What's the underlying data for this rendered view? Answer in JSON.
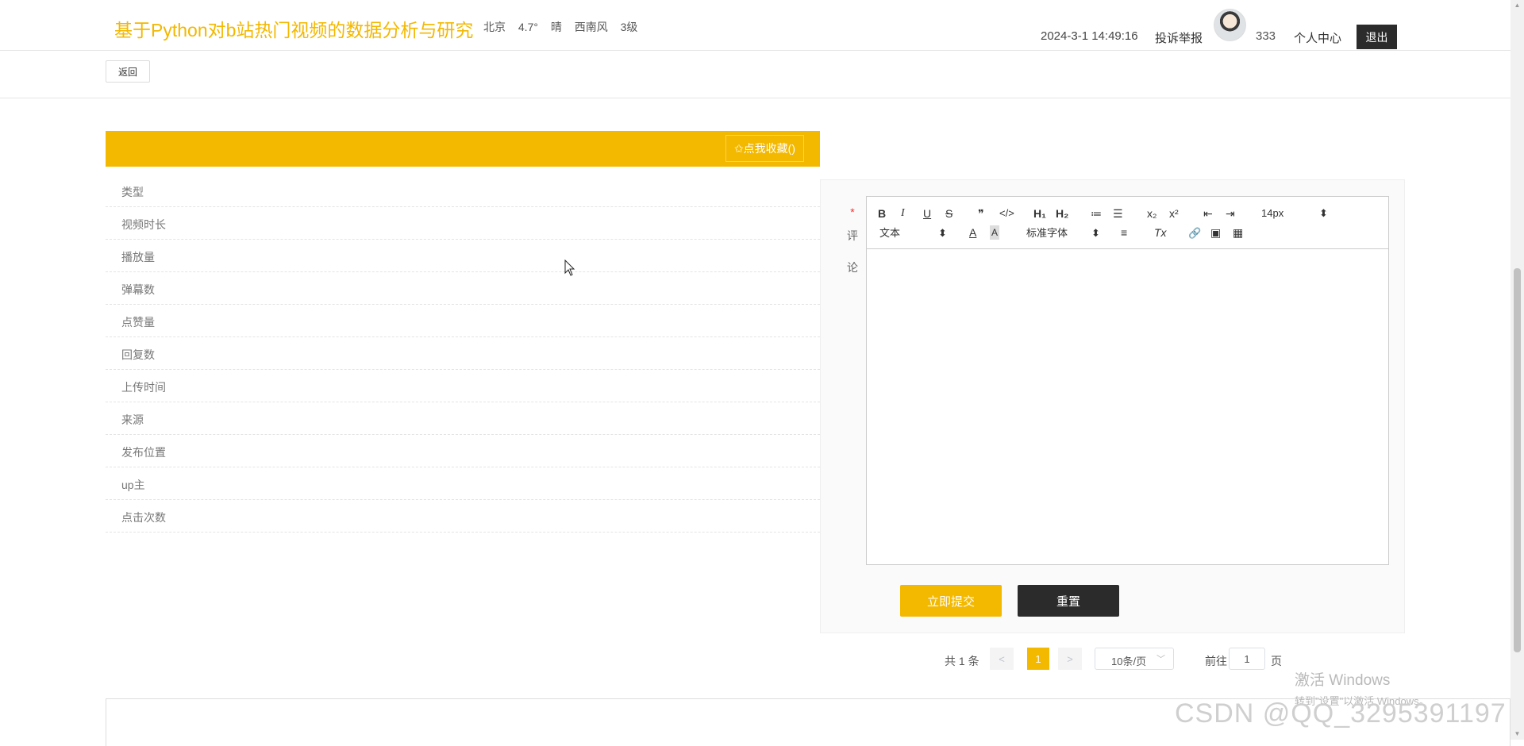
{
  "header": {
    "site_title": "基于Python对b站热门视频的数据分析与研究",
    "weather": {
      "city": "北京",
      "temp": "4.7°",
      "condition": "晴",
      "wind": "西南风",
      "level": "3级"
    },
    "datetime": "2024-3-1 14:49:16",
    "report_link": "投诉举报",
    "username": "333",
    "personal_center": "个人中心",
    "logout": "退出"
  },
  "back_button": "返回",
  "detail": {
    "favorite_button": "✩点我收藏()",
    "labels": [
      "类型",
      "视频时长",
      "播放量",
      "弹幕数",
      "点赞量",
      "回复数",
      "上传时间",
      "来源",
      "发布位置",
      "up主",
      "点击次数"
    ]
  },
  "comment": {
    "required_mark": "*",
    "label_1": "评",
    "label_2": "论",
    "toolbar": {
      "bold": "B",
      "italic": "I",
      "underline": "U",
      "strike": "S",
      "quote": "❞",
      "code": "</>",
      "h1": "H₁",
      "h2": "H₂",
      "ordered_list": "≔",
      "bullet_list": "☰",
      "subscript": "x₂",
      "superscript": "x²",
      "outdent": "⇤",
      "indent": "⇥",
      "size": "14px",
      "size_arrow": "⬍",
      "block": "文本",
      "block_arrow": "⬍",
      "color": "A",
      "background": "A",
      "font": "标准字体",
      "font_arrow": "⬍",
      "align": "≡",
      "clean": "Tx",
      "link": "🔗",
      "image": "▣",
      "video": "▦"
    },
    "submit": "立即提交",
    "reset": "重置"
  },
  "pagination": {
    "total": "共 1 条",
    "prev": "<",
    "current_page": "1",
    "next": ">",
    "page_size": "10条/页",
    "goto_label": "前往",
    "goto_value": "1",
    "page_unit": "页"
  },
  "watermark": {
    "windows_line1": "激活 Windows",
    "windows_line2": "转到\"设置\"以激活 Windows。",
    "csdn": "CSDN @QQ_3295391197"
  },
  "colors": {
    "accent": "#f3b800",
    "dark": "#2b2b2b"
  }
}
